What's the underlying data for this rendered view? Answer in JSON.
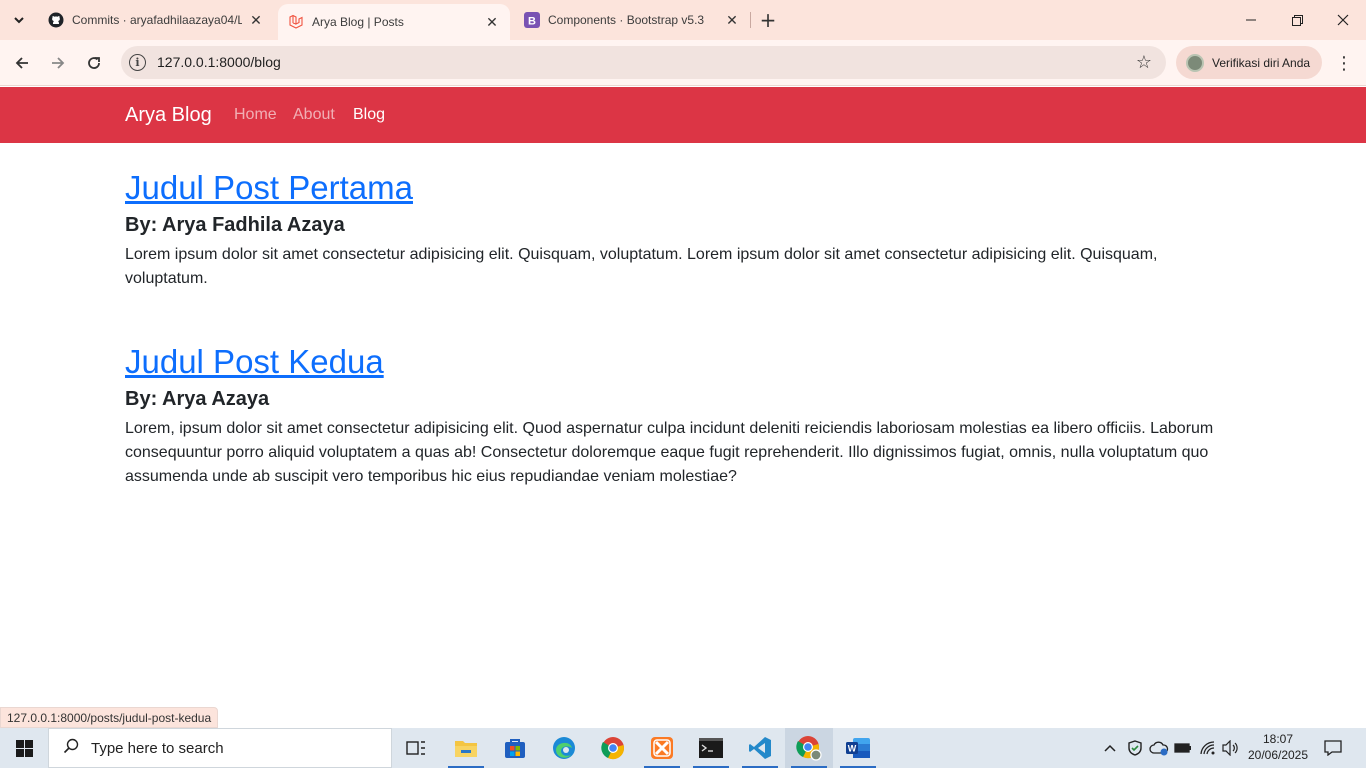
{
  "browser": {
    "tabs": [
      {
        "title": "Commits · aryafadhilaazaya04/L",
        "favicon": "github-icon",
        "active": false
      },
      {
        "title": "Arya Blog | Posts",
        "favicon": "laravel-icon",
        "active": true
      },
      {
        "title": "Components · Bootstrap v5.3",
        "favicon": "bootstrap-icon",
        "active": false
      }
    ],
    "url": "127.0.0.1:8000/blog",
    "profile_label": "Verifikasi diri Anda",
    "status_url": "127.0.0.1:8000/posts/judul-post-kedua"
  },
  "site": {
    "brand": "Arya Blog",
    "nav": [
      {
        "label": "Home",
        "active": false
      },
      {
        "label": "About",
        "active": false
      },
      {
        "label": "Blog",
        "active": true
      }
    ],
    "navbar_color": "#dc3545",
    "link_color": "#0d6efd"
  },
  "posts": [
    {
      "title": "Judul Post Pertama",
      "author": "By: Arya Fadhila Azaya",
      "body": "Lorem ipsum dolor sit amet consectetur adipisicing elit. Quisquam, voluptatum. Lorem ipsum dolor sit amet consectetur adipisicing elit. Quisquam, voluptatum."
    },
    {
      "title": "Judul Post Kedua",
      "author": "By: Arya Azaya",
      "body": "Lorem, ipsum dolor sit amet consectetur adipisicing elit. Quod aspernatur culpa incidunt deleniti reiciendis laboriosam molestias ea libero officiis. Laborum consequuntur porro aliquid voluptatem a quas ab! Consectetur doloremque eaque fugit reprehenderit. Illo dignissimos fugiat, omnis, nulla voluptatum quo assumenda unde ab suscipit vero temporibus hic eius repudiandae veniam molestiae?"
    }
  ],
  "taskbar": {
    "search_placeholder": "Type here to search",
    "time": "18:07",
    "date": "20/06/2025",
    "apps": [
      "task-view-icon",
      "file-explorer-icon",
      "microsoft-store-icon",
      "edge-icon",
      "chrome-icon",
      "xampp-icon",
      "terminal-icon",
      "vscode-icon",
      "chrome-profile-icon",
      "word-icon"
    ]
  }
}
